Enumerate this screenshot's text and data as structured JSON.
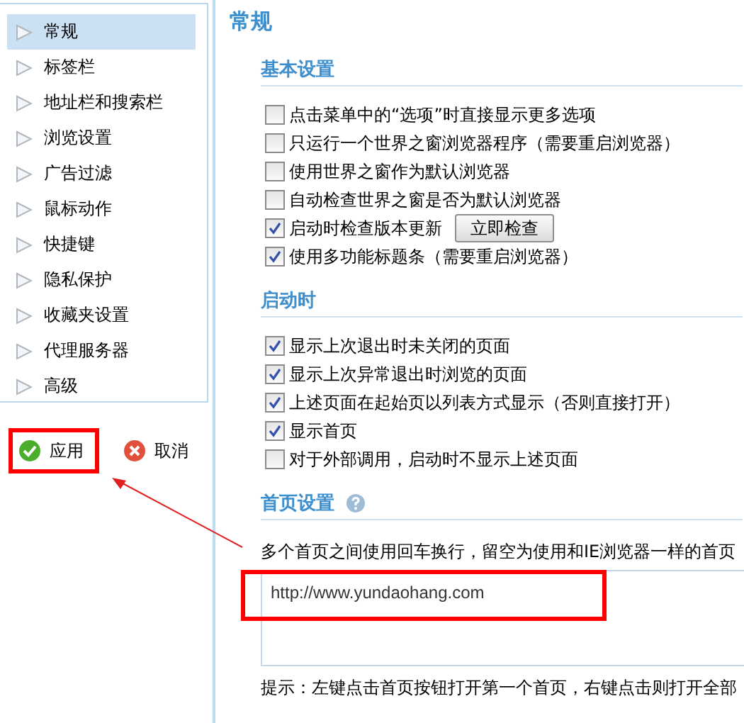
{
  "sidebar": {
    "items": [
      {
        "label": "常规",
        "selected": true
      },
      {
        "label": "标签栏",
        "selected": false
      },
      {
        "label": "地址栏和搜索栏",
        "selected": false
      },
      {
        "label": "浏览设置",
        "selected": false
      },
      {
        "label": "广告过滤",
        "selected": false
      },
      {
        "label": "鼠标动作",
        "selected": false
      },
      {
        "label": "快捷键",
        "selected": false
      },
      {
        "label": "隐私保护",
        "selected": false
      },
      {
        "label": "收藏夹设置",
        "selected": false
      },
      {
        "label": "代理服务器",
        "selected": false
      },
      {
        "label": "高级",
        "selected": false
      }
    ]
  },
  "actions": [
    {
      "kind": "apply",
      "label": "应用",
      "highlighted": true
    },
    {
      "kind": "cancel",
      "label": "取消",
      "highlighted": false
    }
  ],
  "page_title": "常规",
  "sections": [
    {
      "title": "基本设置",
      "options": [
        {
          "label": "点击菜单中的“选项”时直接显示更多选项",
          "checked": false
        },
        {
          "label": "只运行一个世界之窗浏览器程序（需要重启浏览器）",
          "checked": false
        },
        {
          "label": "使用世界之窗作为默认浏览器",
          "checked": false
        },
        {
          "label": "自动检查世界之窗是否为默认浏览器",
          "checked": false
        },
        {
          "label": "启动时检查版本更新",
          "checked": true,
          "button": "立即检查"
        },
        {
          "label": "使用多功能标题条（需要重启浏览器）",
          "checked": true
        }
      ]
    },
    {
      "title": "启动时",
      "options": [
        {
          "label": "显示上次退出时未关闭的页面",
          "checked": true
        },
        {
          "label": "显示上次异常退出时浏览的页面",
          "checked": true
        },
        {
          "label": "上述页面在起始页以列表方式显示（否则直接打开）",
          "checked": true
        },
        {
          "label": "显示首页",
          "checked": true
        },
        {
          "label": "对于外部调用，启动时不显示上述页面",
          "checked": false
        }
      ]
    },
    {
      "title": "首页设置",
      "help": true,
      "description": "多个首页之间使用回车换行，留空为使用和IE浏览器一样的首页",
      "homepage": {
        "value": "http://www.yundaohang.com",
        "highlighted": true
      },
      "hint": "提示：左键点击首页按钮打开第一个首页，右键点击则打开全部"
    }
  ]
}
